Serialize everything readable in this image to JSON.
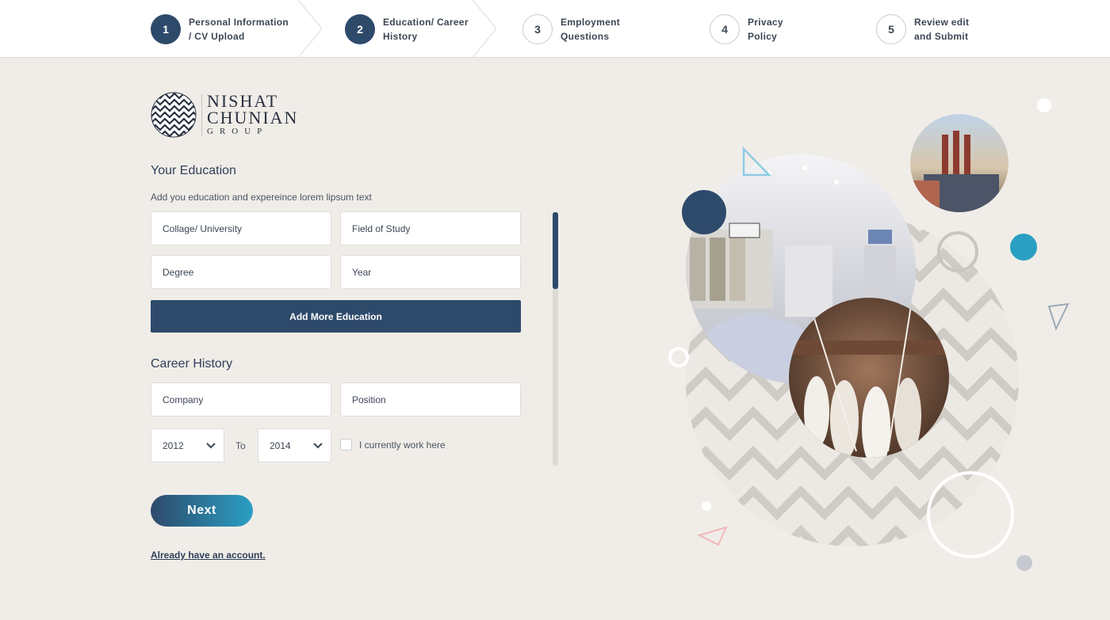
{
  "stepper": {
    "steps": [
      {
        "num": "1",
        "line1": "Personal Information",
        "line2": "/ CV Upload"
      },
      {
        "num": "2",
        "line1": "Education/ Career",
        "line2": "History"
      },
      {
        "num": "3",
        "line1": "Employment",
        "line2": "Questions"
      },
      {
        "num": "4",
        "line1": "Privacy",
        "line2": "Policy"
      },
      {
        "num": "5",
        "line1": "Review edit",
        "line2": "and Submit"
      }
    ]
  },
  "logo": {
    "line1": "NISHAT",
    "line2": "CHUNIAN",
    "line3": "GROUP"
  },
  "education": {
    "title": "Your Education",
    "subtitle": "Add you education and expereince lorem lipsum text",
    "college_placeholder": "Collage/ University",
    "field_placeholder": "Field of Study",
    "degree_placeholder": "Degree",
    "year_placeholder": "Year",
    "add_button": "Add More Education"
  },
  "career": {
    "title": "Career History",
    "company_placeholder": "Company",
    "position_placeholder": "Position",
    "from_year": "2012",
    "to_label": "To",
    "to_year": "2014",
    "current_label": "I currently work here"
  },
  "actions": {
    "next": "Next",
    "login_link": "Already have an account."
  },
  "colors": {
    "primary": "#2e4a6b",
    "accent": "#2a9fc4",
    "background": "#f0ede8"
  }
}
